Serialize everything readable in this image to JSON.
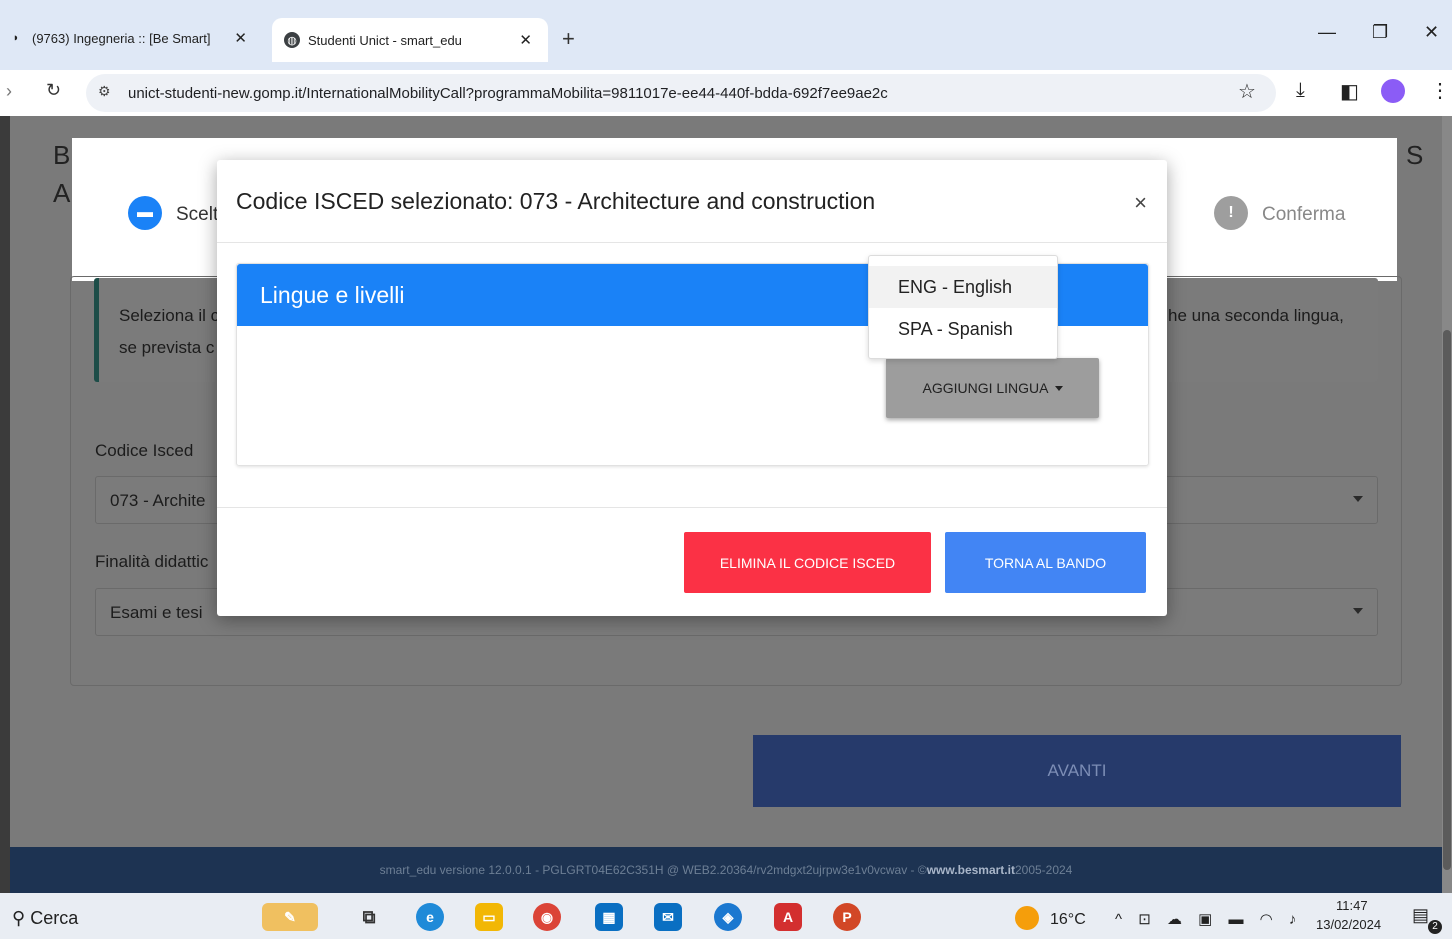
{
  "browser": {
    "tabs": [
      {
        "title": "(9763) Ingegneria :: [Be Smart]",
        "active": false
      },
      {
        "title": "Studenti Unict - smart_edu",
        "active": true
      }
    ],
    "url": "unict-studenti-new.gomp.it/InternationalMobilityCall?programmaMobilita=9811017e-ee44-440f-bdda-692f7ee9ae2c"
  },
  "background": {
    "title_fragment_1": "B",
    "title_fragment_2": "A",
    "title_fragment_right": "S",
    "steps": [
      {
        "label": "Scelt"
      },
      {
        "label": "Conferma"
      }
    ],
    "info_text_left_1": "Seleziona il c",
    "info_text_left_2": "se prevista c",
    "info_text_right": "he una seconda lingua,",
    "codice_isced_label": "Codice Isced",
    "codice_isced_value": "073 - Archite",
    "finalita_label": "Finalità didattic",
    "finalita_value": "Esami e tesi",
    "avanti_label": "AVANTI",
    "footer_text": "smart_edu versione 12.0.0.1 - PGLGRT04E62C351H @ WEB2.20364/rv2mdgxt2ujrpw3e1v0vcwav - © ",
    "footer_link": "www.besmart.it",
    "footer_years": " 2005-2024"
  },
  "modal": {
    "title": "Codice ISCED selezionato: 073 - Architecture and construction",
    "close": "×",
    "section_title": "Lingue e livelli",
    "add_language_label": "AGGIUNGI LINGUA",
    "dropdown_options": [
      "ENG - English",
      "SPA - Spanish"
    ],
    "delete_button": "ELIMINA IL CODICE ISCED",
    "back_button": "TORNA AL BANDO"
  },
  "taskbar": {
    "search_label": "Cerca",
    "weather": "16°C",
    "time": "11:47",
    "date": "13/02/2024",
    "notification_count": "2"
  },
  "colors": {
    "primary_blue": "#1a82f7",
    "danger_red": "#fb3145",
    "back_blue": "#4285f4"
  }
}
